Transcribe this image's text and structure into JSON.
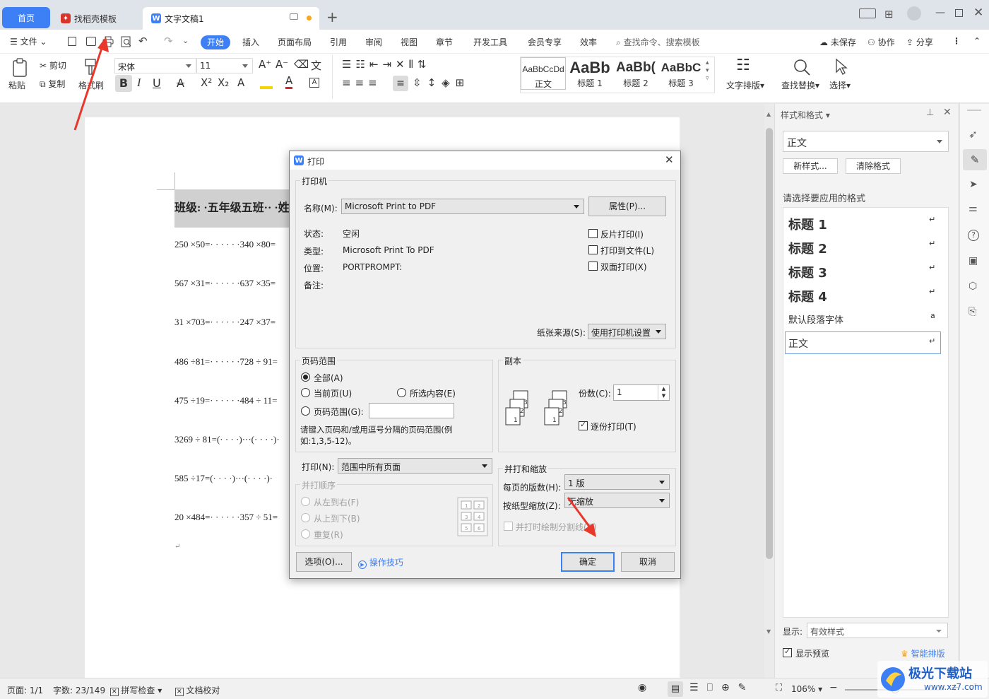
{
  "tabs": {
    "home": "首页",
    "template": "找稻壳模板",
    "document": "文字文稿1"
  },
  "menubar": {
    "file": "文件",
    "items": [
      "开始",
      "插入",
      "页面布局",
      "引用",
      "审阅",
      "视图",
      "章节",
      "开发工具",
      "会员专享",
      "效率"
    ],
    "search": "查找命令、搜索模板",
    "unsaved": "未保存",
    "collab": "协作",
    "share": "分享"
  },
  "ribbon": {
    "paste": "粘贴",
    "cut": "剪切",
    "copy": "复制",
    "format_painter": "格式刷",
    "font_name": "宋体",
    "font_size": "11",
    "styles": [
      {
        "preview": "AaBbCcDd",
        "name": "正文"
      },
      {
        "preview": "AaBb",
        "name": "标题 1"
      },
      {
        "preview": "AaBb(",
        "name": "标题 2"
      },
      {
        "preview": "AaBbC",
        "name": "标题 3"
      }
    ],
    "text_layout": "文字排版",
    "find_replace": "查找替换",
    "select": "选择"
  },
  "document": {
    "heading": "班级:  ·五年级五班·· ·姓",
    "lines": [
      "250 ×50=· · · · · ·340 ×80=",
      "567 ×31=· · · · · ·637 ×35=",
      "31 ×703=· · · · · ·247 ×37=",
      "486 ÷81=· · · · · ·728 ÷ 91=",
      "475 ÷19=· · · · · ·484 ÷ 11=",
      "3269 ÷ 81=(· · · ·)···(· · · ·)·",
      "585 ÷17=(· · · ·)···(· · · ·)·",
      "20 ×484=· · · · · ·357 ÷ 51="
    ]
  },
  "dialog": {
    "title": "打印",
    "printer_group": "打印机",
    "name_label": "名称(M):",
    "printer_name": "Microsoft Print to PDF",
    "properties_btn": "属性(P)...",
    "status_label": "状态:",
    "status_value": "空闲",
    "type_label": "类型:",
    "type_value": "Microsoft Print To PDF",
    "location_label": "位置:",
    "location_value": "PORTPROMPT:",
    "comment_label": "备注:",
    "reverse_print": "反片打印(I)",
    "print_to_file": "打印到文件(L)",
    "duplex": "双面打印(X)",
    "paper_source_label": "纸张来源(S):",
    "paper_source_value": "使用打印机设置",
    "range_group": "页码范围",
    "range_all": "全部(A)",
    "range_current": "当前页(U)",
    "range_selection": "所选内容(E)",
    "range_pages": "页码范围(G):",
    "range_hint": "请键入页码和/或用逗号分隔的页码范围(例如:1,3,5-12)。",
    "copies_group": "副本",
    "copies_label": "份数(C):",
    "copies_value": "1",
    "collate": "逐份打印(T)",
    "print_label": "打印(N):",
    "print_value": "范围中所有页面",
    "order_group": "并打顺序",
    "order_lr": "从左到右(F)",
    "order_tb": "从上到下(B)",
    "order_repeat": "重复(R)",
    "scale_group": "并打和缩放",
    "pages_per_sheet_label": "每页的版数(H):",
    "pages_per_sheet_value": "1 版",
    "scale_label": "按纸型缩放(Z):",
    "scale_value": "无缩放",
    "draw_borders": "并打时绘制分割线(D)",
    "options_btn": "选项(O)...",
    "tips_link": "操作技巧",
    "ok_btn": "确定",
    "cancel_btn": "取消"
  },
  "panel": {
    "title": "样式和格式",
    "current_style": "正文",
    "new_style": "新样式...",
    "clear_format": "清除格式",
    "apply_prompt": "请选择要应用的格式",
    "styles": [
      "标题 1",
      "标题 2",
      "标题 3",
      "标题 4",
      "默认段落字体",
      "正文"
    ],
    "show_label": "显示:",
    "show_value": "有效样式",
    "preview_label": "显示预览",
    "smart_layout": "智能排版"
  },
  "statusbar": {
    "page": "页面: 1/1",
    "words": "字数: 23/149",
    "spell": "拼写检查",
    "proof": "文档校对",
    "zoom": "106%"
  },
  "watermark": {
    "site": "极光下载站",
    "url": "www.xz7.com"
  },
  "colors": {
    "accent": "#3d7ff5",
    "arrow": "#e8382c"
  }
}
